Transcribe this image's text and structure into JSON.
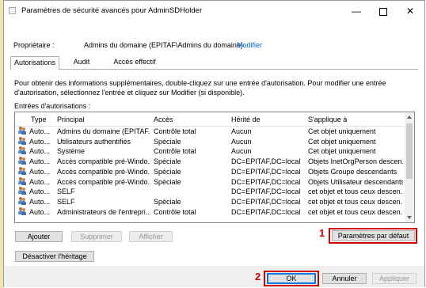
{
  "window": {
    "title": "Paramètres de sécurité avancés pour AdminSDHolder",
    "minimize": "—",
    "close": "✕"
  },
  "owner": {
    "label": "Propriétaire :",
    "value": "Admins du domaine (EPITAF\\Admins du domaine)",
    "link": "Modifier"
  },
  "tabs": [
    "Autorisations",
    "Audit",
    "Accès effectif"
  ],
  "info_text": "Pour obtenir des informations supplémentaires, double-cliquez sur une entrée d'autorisation. Pour modifier une entrée d'autorisation, sélectionnez l'entrée et cliquez sur Modifier (si disponible).",
  "entries_label": "Entrées d'autorisations :",
  "table": {
    "columns": [
      "Type",
      "Principal",
      "Accès",
      "Hérité de",
      "S'applique à"
    ],
    "rows": [
      {
        "type": "Auto...",
        "principal": "Admins du domaine (EPITAF...",
        "acces": "Contrôle total",
        "herite": "Aucun",
        "applique": "Cet objet uniquement"
      },
      {
        "type": "Auto...",
        "principal": "Utilisateurs authentifiés",
        "acces": "Spéciale",
        "herite": "Aucun",
        "applique": "Cet objet uniquement"
      },
      {
        "type": "Auto...",
        "principal": "Système",
        "acces": "Contrôle total",
        "herite": "Aucun",
        "applique": "Cet objet uniquement"
      },
      {
        "type": "Auto...",
        "principal": "Accès compatible pré-Windo...",
        "acces": "Spéciale",
        "herite": "DC=EPITAF,DC=local",
        "applique": "Objets InetOrgPerson descen..."
      },
      {
        "type": "Auto...",
        "principal": "Accès compatible pré-Windo...",
        "acces": "Spéciale",
        "herite": "DC=EPITAF,DC=local",
        "applique": "Objets Groupe descendants"
      },
      {
        "type": "Auto...",
        "principal": "Accès compatible pré-Windo...",
        "acces": "Spéciale",
        "herite": "DC=EPITAF,DC=local",
        "applique": "Objets Utilisateur descendants"
      },
      {
        "type": "Auto...",
        "principal": "SELF",
        "acces": "",
        "herite": "DC=EPITAF,DC=local",
        "applique": "cet objet et tous ceux descen..."
      },
      {
        "type": "Auto...",
        "principal": "SELF",
        "acces": "Spéciale",
        "herite": "DC=EPITAF,DC=local",
        "applique": "cet objet et tous ceux descen..."
      },
      {
        "type": "Auto...",
        "principal": "Administrateurs de l'entrepri...",
        "acces": "Contrôle total",
        "herite": "DC=EPITAF,DC=local",
        "applique": "cet objet et tous ceux descen..."
      }
    ]
  },
  "buttons": {
    "ajouter": "Ajouter",
    "supprimer": "Supprimer",
    "afficher": "Afficher",
    "defaults": "Paramètres par défaut",
    "desactiver": "Désactiver l'héritage",
    "ok": "OK",
    "annuler": "Annuler",
    "appliquer": "Appliquer"
  },
  "annotations": {
    "badge1": "1",
    "badge2": "2",
    "color": "#d10000"
  }
}
